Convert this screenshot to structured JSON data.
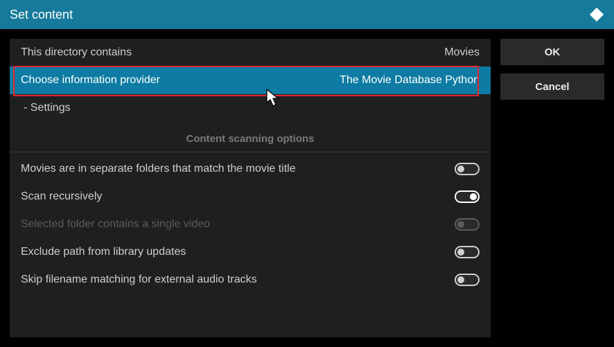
{
  "header": {
    "title": "Set content"
  },
  "rows": {
    "directory": {
      "label": "This directory contains",
      "value": "Movies"
    },
    "provider": {
      "label": "Choose information provider",
      "value": "The Movie Database Python"
    },
    "settings": {
      "label": "- Settings"
    }
  },
  "sectionHeading": "Content scanning options",
  "options": {
    "separateFolders": {
      "label": "Movies are in separate folders that match the movie title"
    },
    "scanRecursively": {
      "label": "Scan recursively"
    },
    "singleVideo": {
      "label": "Selected folder contains a single video"
    },
    "excludePath": {
      "label": "Exclude path from library updates"
    },
    "skipFilename": {
      "label": "Skip filename matching for external audio tracks"
    }
  },
  "buttons": {
    "ok": "OK",
    "cancel": "Cancel"
  }
}
